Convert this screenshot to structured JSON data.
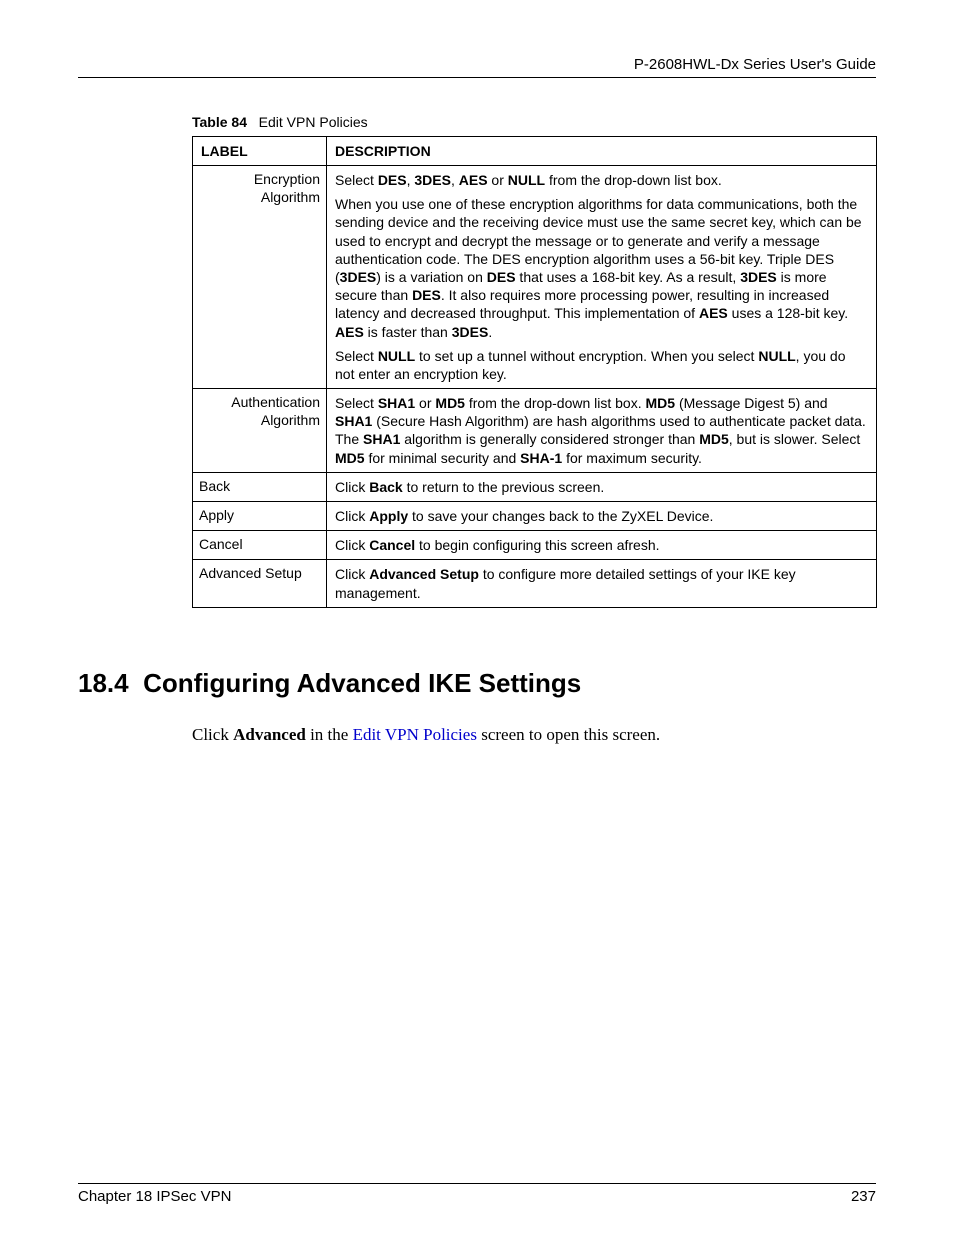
{
  "header": {
    "title": "P-2608HWL-Dx Series User's Guide"
  },
  "table_caption": {
    "num": "Table 84",
    "title": "Edit VPN Policies"
  },
  "table": {
    "head": {
      "label": "LABEL",
      "description": "DESCRIPTION"
    },
    "rows": {
      "enc": {
        "label": "Encryption Algorithm",
        "p1": {
          "a": "Select ",
          "b1": "DES",
          "c1": ", ",
          "b2": "3DES",
          "c2": ", ",
          "b3": "AES",
          "c3": " or ",
          "b4": "NULL",
          "d": " from the drop-down list box."
        },
        "p2": {
          "a": "When you use one of these encryption algorithms for data communications, both the sending device and the receiving device must use the same secret key, which can be used to encrypt and decrypt the message or to generate and verify a message authentication code. The DES encryption algorithm uses a 56-bit key. Triple DES (",
          "b1": "3DES",
          "c1": ") is a variation on ",
          "b2": "DES",
          "c2": " that uses a 168-bit key. As a result, ",
          "b3": "3DES",
          "c3": " is more secure than ",
          "b4": "DES",
          "c4": ". It also requires more processing power, resulting in increased latency and decreased throughput. This implementation of ",
          "b5": "AES",
          "c5": " uses a 128-bit key. ",
          "b6": "AES",
          "c6": " is faster than ",
          "b7": "3DES",
          "d": "."
        },
        "p3": {
          "a": "Select ",
          "b1": "NULL",
          "c1": " to set up a tunnel without encryption. When you select ",
          "b2": "NULL",
          "d": ", you do not enter an encryption key."
        }
      },
      "auth": {
        "label": "Authentication Algorithm",
        "p1": {
          "a": "Select ",
          "b1": "SHA1",
          "c1": " or ",
          "b2": "MD5",
          "c2": " from the drop-down list box. ",
          "b3": "MD5",
          "c3": " (Message Digest 5) and ",
          "b4": "SHA1",
          "c4": " (Secure Hash Algorithm) are hash algorithms used to authenticate packet data. The ",
          "b5": "SHA1",
          "c5": " algorithm is generally considered stronger than ",
          "b6": "MD5",
          "c6": ", but is slower. Select ",
          "b7": "MD5",
          "c7": " for minimal security and ",
          "b8": "SHA-1",
          "d": " for maximum security."
        }
      },
      "back": {
        "label": "Back",
        "p1": {
          "a": "Click ",
          "b1": "Back",
          "d": " to return to the previous screen."
        }
      },
      "apply": {
        "label": "Apply",
        "p1": {
          "a": "Click ",
          "b1": "Apply",
          "d": " to save your changes back to the ZyXEL Device."
        }
      },
      "cancel": {
        "label": "Cancel",
        "p1": {
          "a": "Click ",
          "b1": "Cancel",
          "d": " to begin configuring this screen afresh."
        }
      },
      "adv": {
        "label": "Advanced Setup",
        "p1": {
          "a": "Click ",
          "b1": "Advanced Setup",
          "d": " to configure more detailed settings of your IKE key management."
        }
      }
    }
  },
  "section": {
    "num": "18.4",
    "title": "Configuring Advanced IKE Settings"
  },
  "body": {
    "a": "Click ",
    "b1": "Advanced",
    "c1": " in the ",
    "link": "Edit VPN Policies",
    "d": " screen to open this screen."
  },
  "footer": {
    "left": "Chapter 18 IPSec VPN",
    "right": "237"
  }
}
